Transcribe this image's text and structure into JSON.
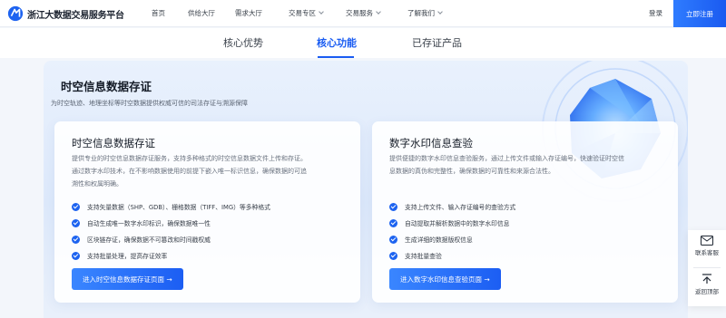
{
  "header": {
    "brand": "浙江大数据交易服务平台",
    "nav": [
      {
        "label": "首页",
        "dropdown": false
      },
      {
        "label": "供给大厅",
        "dropdown": false
      },
      {
        "label": "需求大厅",
        "dropdown": false
      },
      {
        "label": "交易专区",
        "dropdown": true
      },
      {
        "label": "交易服务",
        "dropdown": true
      },
      {
        "label": "了解我们",
        "dropdown": true
      }
    ],
    "login_label": "登录",
    "register_label": "立即注册"
  },
  "tabs": [
    {
      "label": "核心优势",
      "active": false
    },
    {
      "label": "核心功能",
      "active": true
    },
    {
      "label": "已存证产品",
      "active": false
    }
  ],
  "hero": {
    "title": "时空信息数据存证",
    "subtitle": "为时空轨迹、地理坐标等时空数据提供权威可信的司法存证与溯源保障"
  },
  "cards": [
    {
      "title": "时空信息数据存证",
      "description": "提供专业的时空信息数据存证服务，支持多种格式的时空信息数据文件上传和存证。通过数字水印技术，在不影响数据使用的前提下嵌入唯一标识信息，确保数据的可追溯性和权属明确。",
      "features": [
        "支持矢量数据（SHP、GDB）、栅格数据（TIFF、IMG）等多种格式",
        "自动生成唯一数字水印标识，确保数据唯一性",
        "区块链存证，确保数据不可篡改和时间戳权威",
        "支持批量处理，提高存证效率"
      ],
      "cta": "进入时空信息数据存证页面 →"
    },
    {
      "title": "数字水印信息查验",
      "description": "提供便捷的数字水印信息查验服务，通过上传文件或输入存证编号，快速验证时空信息数据的真伪和完整性，确保数据的可靠性和来源合法性。",
      "features": [
        "支持上传文件、输入存证编号的查验方式",
        "自动提取并解析数据中的数字水印信息",
        "生成详细的数据版权信息",
        "支持批量查验"
      ],
      "cta": "进入数字水印信息查验页面 →"
    }
  ],
  "sidebar": {
    "contact_label": "联系客服",
    "top_label": "返回顶部"
  },
  "colors": {
    "accent": "#1a5cf2",
    "check": "#1d63f0"
  },
  "icons": {
    "brand": "brand-logo-icon",
    "check": "check-circle-icon",
    "mail": "mail-icon",
    "back_to_top": "back-to-top-icon"
  }
}
